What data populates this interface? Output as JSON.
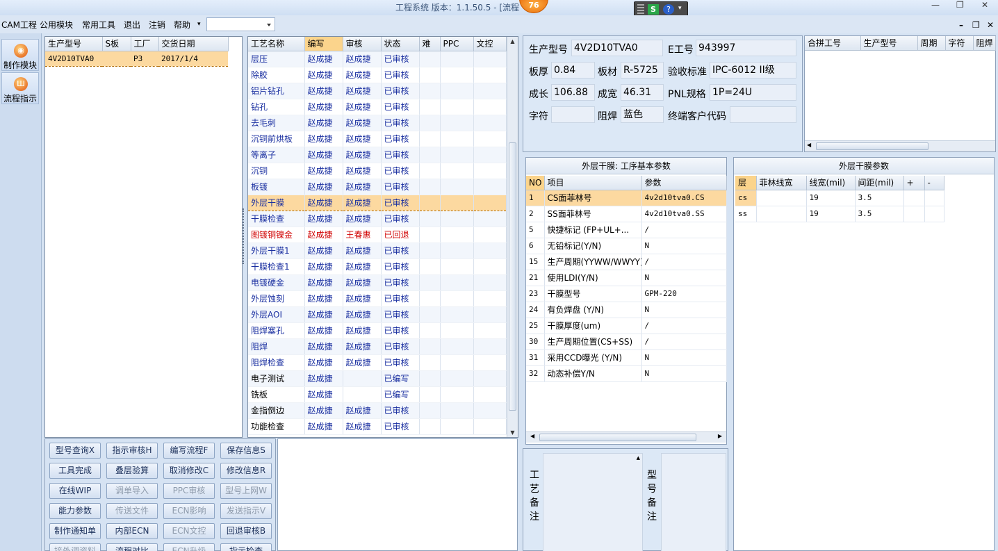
{
  "title": {
    "text": "工程系统    版本：1.1.50.5 - [流程",
    "badge": "76",
    "tray_s": "S",
    "tray_help": "?",
    "minimize": "—",
    "restore": "❐",
    "close": "✕"
  },
  "menu": {
    "items": [
      "CAM工程",
      "公用模块",
      "常用工具",
      "退出",
      "注销",
      "帮助"
    ],
    "help_arrow": "▾",
    "mdi_min": "–",
    "mdi_restore": "❐",
    "mdi_close": "✕"
  },
  "nav": [
    {
      "label": "制作模块",
      "icon": "flame-icon",
      "glyph": "◉"
    },
    {
      "label": "流程指示",
      "icon": "flow-icon",
      "glyph": "Ш"
    }
  ],
  "orders": {
    "headers": [
      "生产型号",
      "S板",
      "工厂",
      "交货日期"
    ],
    "rows": [
      [
        "4V2D10TVA0",
        "",
        "P3",
        "2017/1/4"
      ]
    ]
  },
  "process": {
    "headers": [
      "工艺名称",
      "编写",
      "审核",
      "状态",
      "难",
      "PPC",
      "文控"
    ],
    "rows": [
      [
        "层压",
        "赵成捷",
        "赵成捷",
        "已审核"
      ],
      [
        "除胶",
        "赵成捷",
        "赵成捷",
        "已审核"
      ],
      [
        "铝片钻孔",
        "赵成捷",
        "赵成捷",
        "已审核"
      ],
      [
        "钻孔",
        "赵成捷",
        "赵成捷",
        "已审核"
      ],
      [
        "去毛刺",
        "赵成捷",
        "赵成捷",
        "已审核"
      ],
      [
        "沉铜前烘板",
        "赵成捷",
        "赵成捷",
        "已审核"
      ],
      [
        "等离子",
        "赵成捷",
        "赵成捷",
        "已审核"
      ],
      [
        "沉铜",
        "赵成捷",
        "赵成捷",
        "已审核"
      ],
      [
        "板镀",
        "赵成捷",
        "赵成捷",
        "已审核"
      ],
      [
        "外层干膜",
        "赵成捷",
        "赵成捷",
        "已审核"
      ],
      [
        "干膜检查",
        "赵成捷",
        "赵成捷",
        "已审核"
      ],
      [
        "图镀铜镍金",
        "赵成捷",
        "王春惠",
        "已回退"
      ],
      [
        "外层干膜1",
        "赵成捷",
        "赵成捷",
        "已审核"
      ],
      [
        "干膜检查1",
        "赵成捷",
        "赵成捷",
        "已审核"
      ],
      [
        "电镀硬金",
        "赵成捷",
        "赵成捷",
        "已审核"
      ],
      [
        "外层蚀刻",
        "赵成捷",
        "赵成捷",
        "已审核"
      ],
      [
        "外层AOI",
        "赵成捷",
        "赵成捷",
        "已审核"
      ],
      [
        "阻焊塞孔",
        "赵成捷",
        "赵成捷",
        "已审核"
      ],
      [
        "阻焊",
        "赵成捷",
        "赵成捷",
        "已审核"
      ],
      [
        "阻焊检查",
        "赵成捷",
        "赵成捷",
        "已审核"
      ],
      [
        "电子测试",
        "赵成捷",
        "",
        "已编写"
      ],
      [
        "铣板",
        "赵成捷",
        "",
        "已编写"
      ],
      [
        "金指倒边",
        "赵成捷",
        "赵成捷",
        "已审核"
      ],
      [
        "功能检查",
        "赵成捷",
        "赵成捷",
        "已审核"
      ]
    ]
  },
  "actions": [
    [
      "型号查询X",
      "指示审核H",
      "编写流程F",
      "保存信息S"
    ],
    [
      "工具完成",
      "叠层验算",
      "取消修改C",
      "修改信息R"
    ],
    [
      "在线WIP",
      "调单导入",
      "PPC审核",
      "型号上网W"
    ],
    [
      "能力参数",
      "传送文件",
      "ECN影响",
      "发送指示V"
    ],
    [
      "制作通知单",
      "内部ECN",
      "ECN文控",
      "回退审核B"
    ],
    [
      "接外调资料",
      "流程对比",
      "ECN升级",
      "指示检查"
    ]
  ],
  "info": {
    "model_label": "生产型号",
    "model": "4V2D10TVA0",
    "eno_label": "E工号",
    "eno": "943997",
    "thick_label": "板厚",
    "thick": "0.84",
    "material_label": "板材",
    "material": "R-5725",
    "std_label": "验收标准",
    "std": "IPC-6012 II级",
    "len_label": "成长",
    "len": "106.88",
    "wid_label": "成宽",
    "wid": "46.31",
    "pnl_label": "PNL规格",
    "pnl": "1P=24U",
    "char_label": "字符",
    "char": "",
    "mask_label": "阻焊",
    "mask": "蓝色",
    "cust_label": "终端客户代码",
    "cust": ""
  },
  "merge": {
    "headers": [
      "合拼工号",
      "生产型号",
      "周期",
      "字符",
      "阻焊"
    ]
  },
  "params": {
    "title": "外层干膜: 工序基本参数",
    "headers": [
      "NO",
      "项目",
      "参数"
    ],
    "rows": [
      [
        "1",
        "CS面菲林号",
        "4v2d10tva0.CS"
      ],
      [
        "2",
        "SS面菲林号",
        "4v2d10tva0.SS"
      ],
      [
        "5",
        "快捷标记 (FP+UL+...",
        "/"
      ],
      [
        "6",
        "无铅标记(Y/N)",
        "N"
      ],
      [
        "15",
        "生产周期(YYWW/WWYY)",
        "/"
      ],
      [
        "21",
        "使用LDI(Y/N)",
        "N"
      ],
      [
        "23",
        "干膜型号",
        "GPM-220"
      ],
      [
        "24",
        "有负焊盘 (Y/N)",
        "N"
      ],
      [
        "25",
        "干膜厚度(um)",
        "/"
      ],
      [
        "30",
        "生产周期位置(CS+SS)",
        "/"
      ],
      [
        "31",
        "采用CCD曝光 (Y/N)",
        "N"
      ],
      [
        "32",
        "动态补偿Y/N",
        "N"
      ]
    ]
  },
  "layers": {
    "title": "外层干膜参数",
    "headers": [
      "层",
      "菲林线宽",
      "线宽(mil)",
      "间距(mil)",
      "+",
      "-"
    ],
    "rows": [
      [
        "cs",
        "",
        "19",
        "3.5",
        "",
        ""
      ],
      [
        "ss",
        "",
        "19",
        "3.5",
        "",
        ""
      ]
    ]
  },
  "remarks": {
    "process_label": "工艺备注",
    "model_label": "型号备注"
  },
  "colors": {
    "selected": "#fcd9a0",
    "text_blue": "#1a2fa0",
    "reject_red": "#d00000"
  }
}
